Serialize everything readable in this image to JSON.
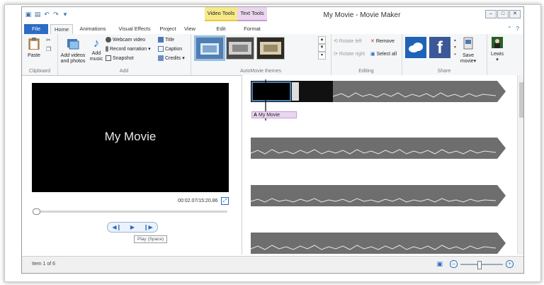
{
  "window": {
    "title": "My Movie - Movie Maker"
  },
  "contextual": {
    "video_tools": "Video Tools",
    "text_tools": "Text Tools"
  },
  "tabs": [
    "File",
    "Home",
    "Animations",
    "Visual Effects",
    "Project",
    "View",
    "Edit",
    "Format"
  ],
  "ribbon": {
    "clipboard": {
      "label": "Clipboard",
      "paste": "Paste"
    },
    "add": {
      "label": "Add",
      "add_videos": "Add videos",
      "and_photos": "and photos",
      "add_music": "Add",
      "add_music_2": "music",
      "webcam": "Webcam video",
      "narration": "Record narration",
      "snapshot": "Snapshot",
      "title": "Title",
      "caption": "Caption",
      "credits": "Credits"
    },
    "themes": {
      "label": "AutoMovie themes"
    },
    "editing": {
      "label": "Editing",
      "rotate_left": "Rotate left",
      "rotate_right": "Rotate right",
      "remove": "Remove",
      "select_all": "Select all"
    },
    "share": {
      "label": "Share",
      "save_movie": "Save",
      "save_movie_2": "movie",
      "user": "Lewis"
    }
  },
  "preview": {
    "title": "My Movie",
    "timecode": "00:02.07/15:20.86",
    "tooltip": "Play (Space)"
  },
  "storyboard": {
    "caption": "My Movie"
  },
  "status": {
    "item": "Item 1 of 6"
  },
  "colors": {
    "accent": "#2b6cc4",
    "video_tools": "#f7e98a",
    "text_tools": "#ead7ef",
    "track": "#6e6e6e"
  }
}
